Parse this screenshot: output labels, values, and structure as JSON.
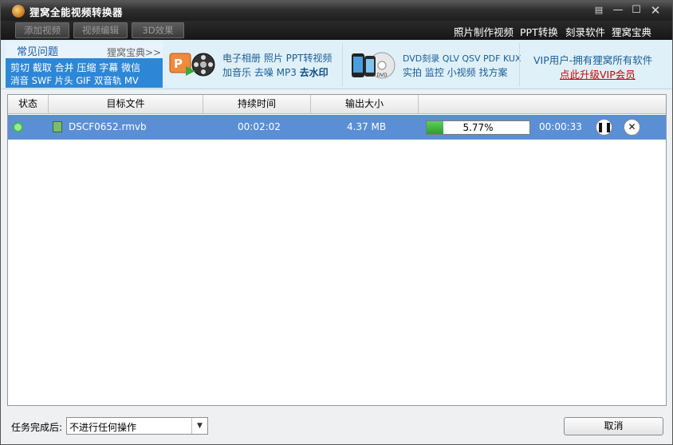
{
  "window": {
    "title": "狸窝全能视频转换器",
    "controls": [
      "restore",
      "minimize",
      "maximize",
      "close"
    ]
  },
  "toolbar": {
    "buttons": [
      "添加视频",
      "视频编辑",
      "3D效果"
    ],
    "links": [
      "照片制作视频",
      "PPT转换",
      "刻录软件",
      "狸窝宝典"
    ]
  },
  "banner": {
    "faq_title": "常见问题",
    "faq_more": "狸窝宝典>>",
    "faq_line1": "剪切 截取 合并 压缩 字幕 微信",
    "faq_line2": "消音 SWF 片头 GIF 双音轨 MV",
    "promo1_line1": "电子相册 照片 PPT转视频",
    "promo1_line2a": "加音乐 去噪 MP3 ",
    "promo1_line2b": "去水印",
    "promo2_line1": "DVD刻录 QLV QSV PDF KUX",
    "promo2_line2": "实拍 监控 小视频 找方案",
    "vip_line1": "VIP用户-拥有狸窝所有软件",
    "vip_link": "点此升级VIP会员"
  },
  "table": {
    "headers": [
      "状态",
      "目标文件",
      "持续时间",
      "输出大小",
      ""
    ],
    "rows": [
      {
        "file": "DSCF0652.rmvb",
        "duration": "00:02:02",
        "size": "4.37 MB",
        "progress_text": "5.77%",
        "progress_fraction": 0.0577,
        "remaining": "00:00:33"
      }
    ]
  },
  "footer": {
    "label": "任务完成后:",
    "select_value": "不进行任何操作",
    "cancel": "取消"
  },
  "colors": {
    "selected_row": "#5a8fd6",
    "progress": "#3cb43c",
    "vip_link": "#cc0000",
    "faq_bg": "#2e87d6"
  }
}
